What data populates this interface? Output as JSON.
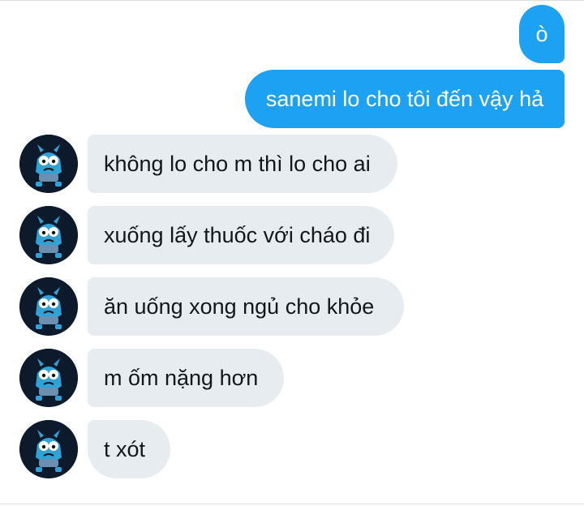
{
  "conversation": {
    "sent": [
      {
        "text": "ò"
      },
      {
        "text": "sanemi lo cho tôi đến vậy hả"
      }
    ],
    "received": [
      {
        "text": "không lo cho m thì lo cho ai"
      },
      {
        "text": "xuống lấy thuốc với cháo đi"
      },
      {
        "text": "ăn uống xong ngủ cho khỏe"
      },
      {
        "text": "m ốm nặng hơn"
      },
      {
        "text": "t xót"
      }
    ]
  },
  "colors": {
    "sent_bubble": "#1da1f2",
    "received_bubble": "#e6ecf0",
    "avatar_background": "#0c1a2c",
    "avatar_character": "#2fa3d6"
  },
  "icons": {
    "avatar": "gumball-cartoon-cat-avatar-icon"
  }
}
